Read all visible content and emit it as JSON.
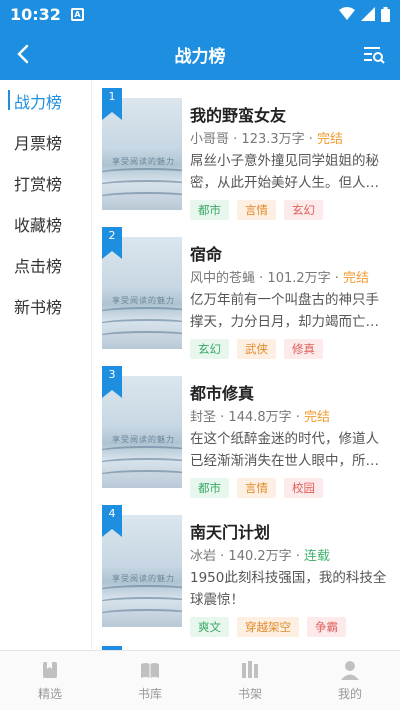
{
  "status_bar": {
    "time": "10:32",
    "app_icon": "A"
  },
  "header": {
    "title": "战力榜"
  },
  "sidebar": {
    "items": [
      {
        "label": "战力榜",
        "active": true
      },
      {
        "label": "月票榜"
      },
      {
        "label": "打赏榜"
      },
      {
        "label": "收藏榜"
      },
      {
        "label": "点击榜"
      },
      {
        "label": "新书榜"
      }
    ]
  },
  "books": [
    {
      "rank": "1",
      "title": "我的野蛮女友",
      "author": "小哥哥",
      "words": "123.3万字",
      "status": "完结",
      "desc": "屌丝小子意外撞见同学姐姐的秘密，从此开始美好人生。但人…",
      "cover_text": "享受阅读的魅力",
      "tags": [
        {
          "label": "都市",
          "color": "green"
        },
        {
          "label": "言情",
          "color": "orange"
        },
        {
          "label": "玄幻",
          "color": "red"
        }
      ]
    },
    {
      "rank": "2",
      "title": "宿命",
      "author": "风中的苍蝇",
      "words": "101.2万字",
      "status": "完结",
      "desc": "亿万年前有一个叫盘古的神只手撑天，力分日月，却力竭而亡…",
      "cover_text": "享受阅读的魅力",
      "tags": [
        {
          "label": "玄幻",
          "color": "green"
        },
        {
          "label": "武侠",
          "color": "orange"
        },
        {
          "label": "修真",
          "color": "red"
        }
      ]
    },
    {
      "rank": "3",
      "title": "都市修真",
      "author": "封圣",
      "words": "144.8万字",
      "status": "完结",
      "desc": "在这个纸醉金迷的时代，修道人已经渐渐消失在世人眼中，所…",
      "cover_text": "享受阅读的魅力",
      "tags": [
        {
          "label": "都市",
          "color": "green"
        },
        {
          "label": "言情",
          "color": "orange"
        },
        {
          "label": "校园",
          "color": "red"
        }
      ]
    },
    {
      "rank": "4",
      "title": "南天门计划",
      "author": "冰岩",
      "words": "140.2万字",
      "status": "连载",
      "desc": "1950此刻科技强国，我的科技全球震惊！",
      "cover_text": "享受阅读的魅力",
      "tags": [
        {
          "label": "爽文",
          "color": "green"
        },
        {
          "label": "穿越架空",
          "color": "orange"
        },
        {
          "label": "争霸",
          "color": "red"
        }
      ]
    }
  ],
  "tabbar": {
    "items": [
      {
        "label": "精选",
        "icon": "featured-icon"
      },
      {
        "label": "书库",
        "icon": "library-icon"
      },
      {
        "label": "书架",
        "icon": "bookshelf-icon"
      },
      {
        "label": "我的",
        "icon": "profile-icon"
      }
    ]
  },
  "colors": {
    "primary": "#1e8fe0",
    "status_finished": "#f29a2e",
    "status_serial": "#43b36d"
  }
}
